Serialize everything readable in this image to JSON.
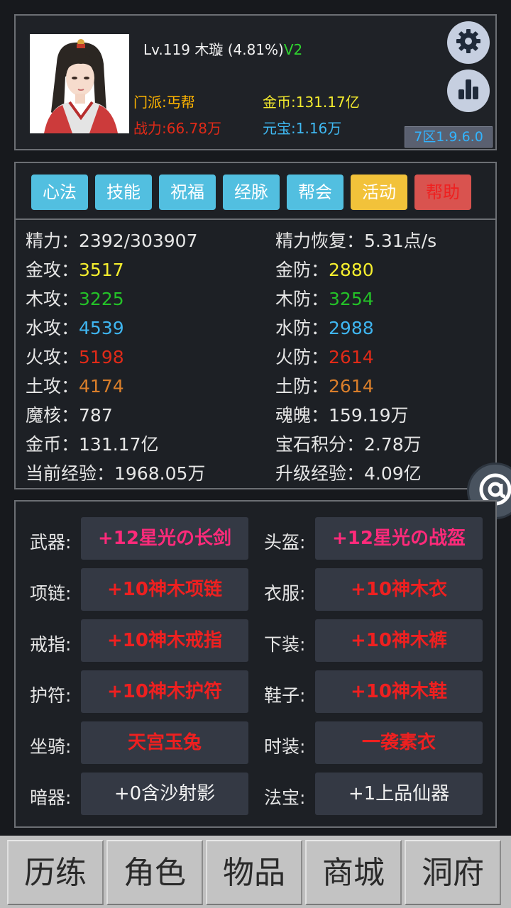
{
  "header": {
    "level": "Lv.119",
    "name": "木璇",
    "progress": "(4.81%)",
    "vip": "V2",
    "sect": "门派:丐帮",
    "power": "战力:66.78万",
    "gold": "金币:131.17亿",
    "ingot": "元宝:1.16万",
    "version": "7区1.9.6.0"
  },
  "tabs": [
    {
      "label": "心法",
      "style": "blue"
    },
    {
      "label": "技能",
      "style": "blue"
    },
    {
      "label": "祝福",
      "style": "blue"
    },
    {
      "label": "经脉",
      "style": "blue"
    },
    {
      "label": "帮会",
      "style": "blue"
    },
    {
      "label": "活动",
      "style": "yellow"
    },
    {
      "label": "帮助",
      "style": "red"
    }
  ],
  "stats": {
    "left": [
      {
        "label": "精力：",
        "value": "2392/303907",
        "color": "#e6e6e6"
      },
      {
        "label": "金攻：",
        "value": "3517",
        "color": "#f5ee2e"
      },
      {
        "label": "木攻：",
        "value": "3225",
        "color": "#24c228"
      },
      {
        "label": "水攻：",
        "value": "4539",
        "color": "#3fb5f0"
      },
      {
        "label": "火攻：",
        "value": "5198",
        "color": "#e02a18"
      },
      {
        "label": "土攻：",
        "value": "4174",
        "color": "#d97e2a"
      },
      {
        "label": "魔核：",
        "value": "787",
        "color": "#e6e6e6"
      },
      {
        "label": "金币：",
        "value": "131.17亿",
        "color": "#e6e6e6"
      },
      {
        "label": "当前经验：",
        "value": "1968.05万",
        "color": "#e6e6e6"
      }
    ],
    "right": [
      {
        "label": "精力恢复：",
        "value": "5.31点/s",
        "color": "#e6e6e6"
      },
      {
        "label": "金防：",
        "value": "2880",
        "color": "#f5ee2e"
      },
      {
        "label": "木防：",
        "value": "3254",
        "color": "#24c228"
      },
      {
        "label": "水防：",
        "value": "2988",
        "color": "#3fb5f0"
      },
      {
        "label": "火防：",
        "value": "2614",
        "color": "#e02a18"
      },
      {
        "label": "土防：",
        "value": "2614",
        "color": "#d97e2a"
      },
      {
        "label": "魂魄：",
        "value": "159.19万",
        "color": "#e6e6e6"
      },
      {
        "label": "宝石积分：",
        "value": "2.78万",
        "color": "#e6e6e6"
      },
      {
        "label": "升级经验：",
        "value": "4.09亿",
        "color": "#e6e6e6"
      }
    ]
  },
  "equipment": {
    "left": [
      {
        "slot": "武器:",
        "item": "+12星光の长剑",
        "style": "pink"
      },
      {
        "slot": "项链:",
        "item": "+10神木项链",
        "style": "red"
      },
      {
        "slot": "戒指:",
        "item": "+10神木戒指",
        "style": "red"
      },
      {
        "slot": "护符:",
        "item": "+10神木护符",
        "style": "red"
      },
      {
        "slot": "坐骑:",
        "item": "天宫玉兔",
        "style": "red"
      },
      {
        "slot": "暗器:",
        "item": "+0含沙射影",
        "style": "white"
      }
    ],
    "right": [
      {
        "slot": "头盔:",
        "item": "+12星光の战盔",
        "style": "pink"
      },
      {
        "slot": "衣服:",
        "item": "+10神木衣",
        "style": "red"
      },
      {
        "slot": "下装:",
        "item": "+10神木裤",
        "style": "red"
      },
      {
        "slot": "鞋子:",
        "item": "+10神木鞋",
        "style": "red"
      },
      {
        "slot": "时装:",
        "item": "一袭素衣",
        "style": "red"
      },
      {
        "slot": "法宝:",
        "item": "+1上品仙器",
        "style": "white"
      }
    ]
  },
  "nav": [
    "历练",
    "角色",
    "物品",
    "商城",
    "洞府"
  ],
  "icons": {
    "settings": "gear-icon",
    "stats": "bar-chart-icon",
    "at": "at-sign-icon",
    "avatar": "character-portrait"
  }
}
